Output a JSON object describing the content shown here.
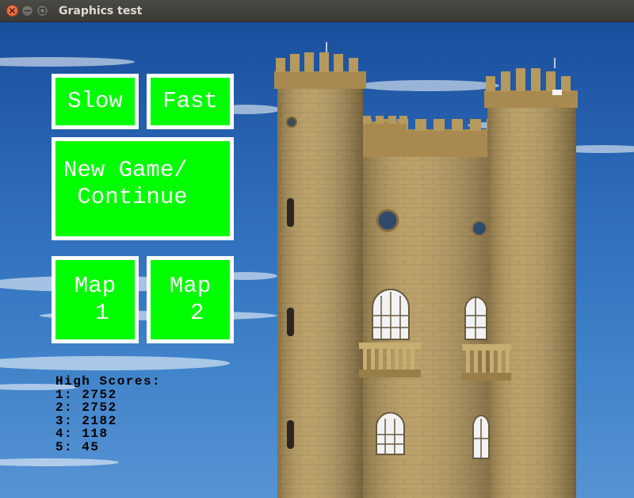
{
  "window": {
    "title": "Graphics test"
  },
  "menu": {
    "slow_label": "Slow",
    "fast_label": "Fast",
    "new_game_label": "New Game/\n Continue",
    "map1_label": "Map\n 1",
    "map2_label": "Map\n 2"
  },
  "high_scores": {
    "heading": "High Scores:",
    "entries": [
      "1: 2752",
      "2: 2752",
      "3: 2182",
      "4: 118",
      "5: 45"
    ]
  },
  "colors": {
    "button_fill": "#00ff00",
    "button_border": "#ffffff",
    "sky": "#2c6ab8",
    "stone": "#b89a5e"
  },
  "icons": {
    "close": "close-icon",
    "minimize": "minimize-icon",
    "maximize": "maximize-icon"
  }
}
